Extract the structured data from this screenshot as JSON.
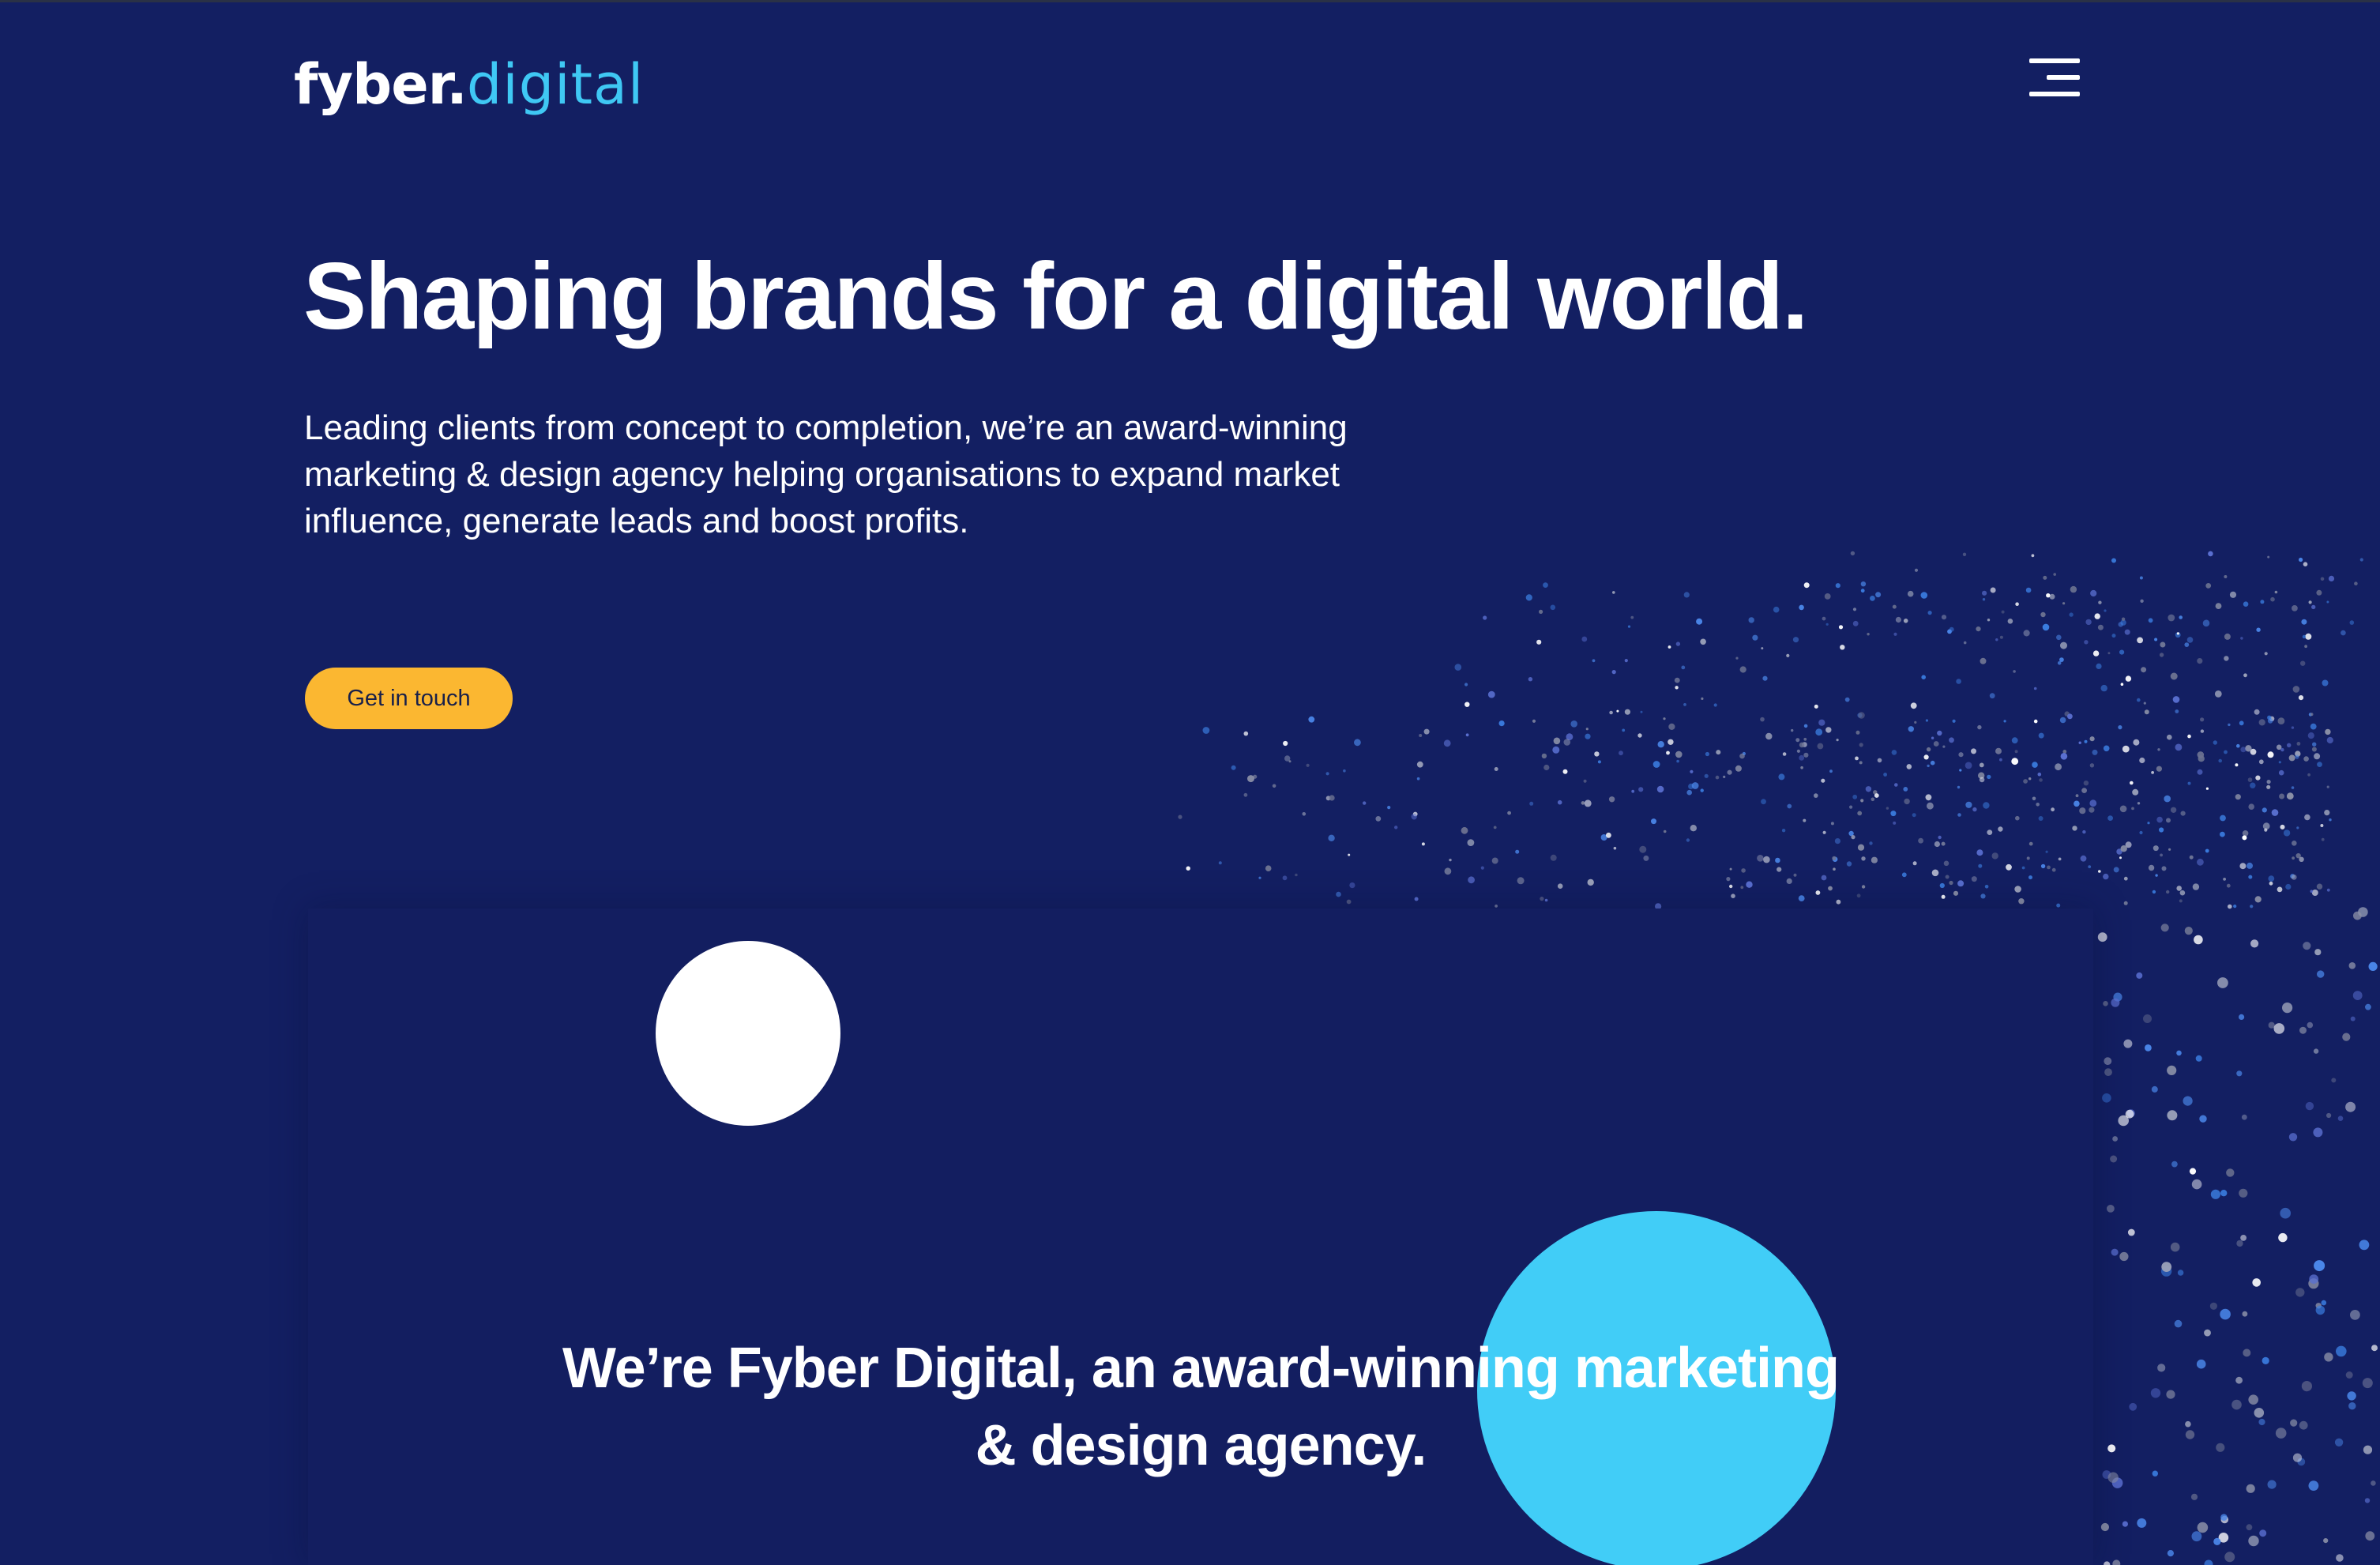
{
  "header": {
    "logo_primary": "fyber.",
    "logo_secondary": "digital",
    "menu_icon": "hamburger-menu-icon"
  },
  "hero": {
    "title": "Shaping brands for a digital world.",
    "subtitle": "Leading clients from concept to completion, we’re an award-winning marketing & design agency helping organisations to expand market influence, generate leads and boost profits.",
    "cta_label": "Get in touch"
  },
  "intro": {
    "statement": "We’re Fyber Digital, an award-winning marketing & design agency."
  },
  "colors": {
    "background": "#131f62",
    "accent_cyan": "#41cdf7",
    "accent_yellow": "#fbb731",
    "text": "#ffffff"
  }
}
